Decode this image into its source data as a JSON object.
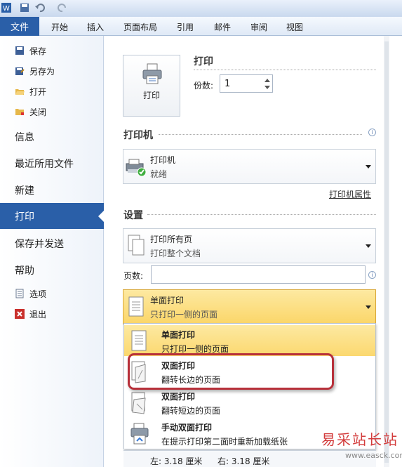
{
  "ribbon": {
    "file_tab": "文件",
    "tabs": [
      "开始",
      "插入",
      "页面布局",
      "引用",
      "邮件",
      "审阅",
      "视图"
    ]
  },
  "sidebar": {
    "save": "保存",
    "save_as": "另存为",
    "open": "打开",
    "close": "关闭",
    "info": "信息",
    "recent": "最近所用文件",
    "new": "新建",
    "print": "打印",
    "save_send": "保存并发送",
    "help": "帮助",
    "options": "选项",
    "exit": "退出"
  },
  "print_section": {
    "button_label": "打印",
    "heading": "打印",
    "copies_label": "份数:",
    "copies_value": "1"
  },
  "printer_section": {
    "heading": "打印机",
    "printer_name": "打印机",
    "printer_status": "就绪",
    "properties_link": "打印机属性"
  },
  "settings_section": {
    "heading": "设置",
    "range_title": "打印所有页",
    "range_desc": "打印整个文档",
    "pages_label": "页数:",
    "pages_value": "",
    "sided_title": "单面打印",
    "sided_desc": "只打印一侧的页面"
  },
  "sided_menu": [
    {
      "title": "单面打印",
      "desc": "只打印一侧的页面"
    },
    {
      "title": "双面打印",
      "desc": "翻转长边的页面"
    },
    {
      "title": "双面打印",
      "desc": "翻转短边的页面"
    },
    {
      "title": "手动双面打印",
      "desc": "在提示打印第二面时重新加载纸张"
    }
  ],
  "margins": {
    "left": "左: 3.18 厘米",
    "right": "右: 3.18 厘米"
  },
  "watermark": {
    "line1": "易采站长站",
    "line2": "www.easck.com"
  },
  "colors": {
    "accent": "#2a5fa8",
    "highlight": "#fbd669",
    "annotation": "#b7303a"
  }
}
